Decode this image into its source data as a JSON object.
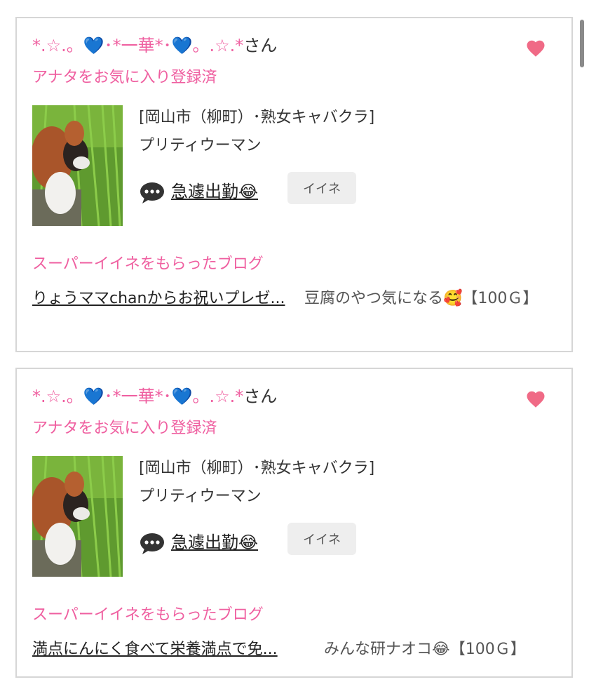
{
  "cards": [
    {
      "name_deco_prefix": "*.☆.。💙･*一華*･💙。.☆.*",
      "name_suffix": "さん",
      "favorite_label": "アナタをお気に入り登録済",
      "shop_area": "[岡山市（柳町）･熟女キャバクラ]",
      "shop_name": "プリティウーマン",
      "diary_title": "急遽出勤😂",
      "iine_label": "イイネ",
      "super_iine_label": "スーパーイイネをもらったブログ",
      "blog_title": "りょうママchanからお祝いプレゼ...",
      "blog_author": "豆腐のやつ気になる🥰【100Ｇ】"
    },
    {
      "name_deco_prefix": "*.☆.。💙･*一華*･💙。.☆.*",
      "name_suffix": "さん",
      "favorite_label": "アナタをお気に入り登録済",
      "shop_area": "[岡山市（柳町）･熟女キャバクラ]",
      "shop_name": "プリティウーマン",
      "diary_title": "急遽出勤😂",
      "iine_label": "イイネ",
      "super_iine_label": "スーパーイイネをもらったブログ",
      "blog_title": "満点にんにく食べて栄養満点で免...",
      "blog_author": "みんな研ナオコ😂【100Ｇ】"
    }
  ],
  "colors": {
    "accent_pink": "#ef5fa0",
    "heart": "#f06a86",
    "border": "#d6d6d6"
  }
}
